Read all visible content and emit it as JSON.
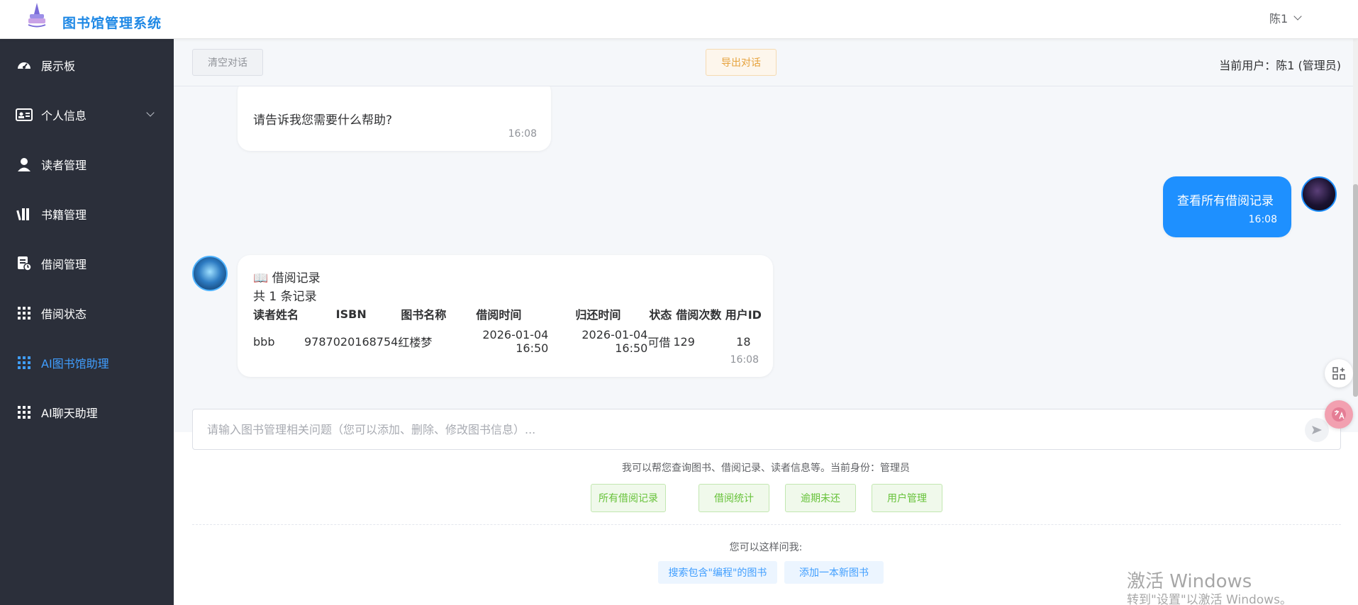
{
  "header": {
    "title": "图书馆管理系统",
    "user_name": "陈1"
  },
  "sidebar": {
    "items": [
      {
        "label": "展示板",
        "icon": "dashboard-icon"
      },
      {
        "label": "个人信息",
        "icon": "id-card-icon"
      },
      {
        "label": "读者管理",
        "icon": "user-icon"
      },
      {
        "label": "书籍管理",
        "icon": "books-icon"
      },
      {
        "label": "借阅管理",
        "icon": "borrow-icon"
      },
      {
        "label": "借阅状态",
        "icon": "grid-icon"
      },
      {
        "label": "AI图书馆助理",
        "icon": "grid-icon",
        "active": true
      },
      {
        "label": "AI聊天助理",
        "icon": "grid-icon"
      }
    ]
  },
  "toolbar": {
    "clear_label": "清空对话",
    "export_label": "导出对话",
    "current_user": "当前用户：陈1 (管理员)"
  },
  "chat": {
    "messages": [
      {
        "role": "bot",
        "text": "请告诉我您需要什么帮助?",
        "time": "16:08"
      },
      {
        "role": "user",
        "text": "查看所有借阅记录",
        "time": "16:08"
      },
      {
        "role": "bot",
        "title": "📖 借阅记录",
        "count": "共 1 条记录",
        "columns": [
          "读者姓名",
          "ISBN",
          "图书名称",
          "借阅时间",
          "归还时间",
          "状态",
          "借阅次数",
          "用户ID"
        ],
        "rows": [
          [
            "bbb",
            "9787020168754",
            "红楼梦",
            "2026-01-04 16:50",
            "2026-01-04 16:50",
            "可借",
            "129",
            "18"
          ]
        ],
        "time": "16:08"
      }
    ]
  },
  "input": {
    "placeholder": "请输入图书管理相关问题（您可以添加、删除、修改图书信息）..."
  },
  "hint": "我可以帮您查询图书、借阅记录、读者信息等。当前身份：管理员",
  "quick_actions": [
    "所有借阅记录",
    "借阅统计",
    "逾期未还",
    "用户管理"
  ],
  "ask_label": "您可以这样问我:",
  "suggestions": [
    "搜索包含\"编程\"的图书",
    "添加一本新图书"
  ],
  "watermark": {
    "line1": "激活 Windows",
    "line2": "转到\"设置\"以激活 Windows。"
  },
  "colors": {
    "sidebar_bg": "#2b2f3a",
    "accent": "#1e90ff",
    "active_nav": "#409eff",
    "export_color": "#e6a23c",
    "quick_color": "#67c23a"
  }
}
